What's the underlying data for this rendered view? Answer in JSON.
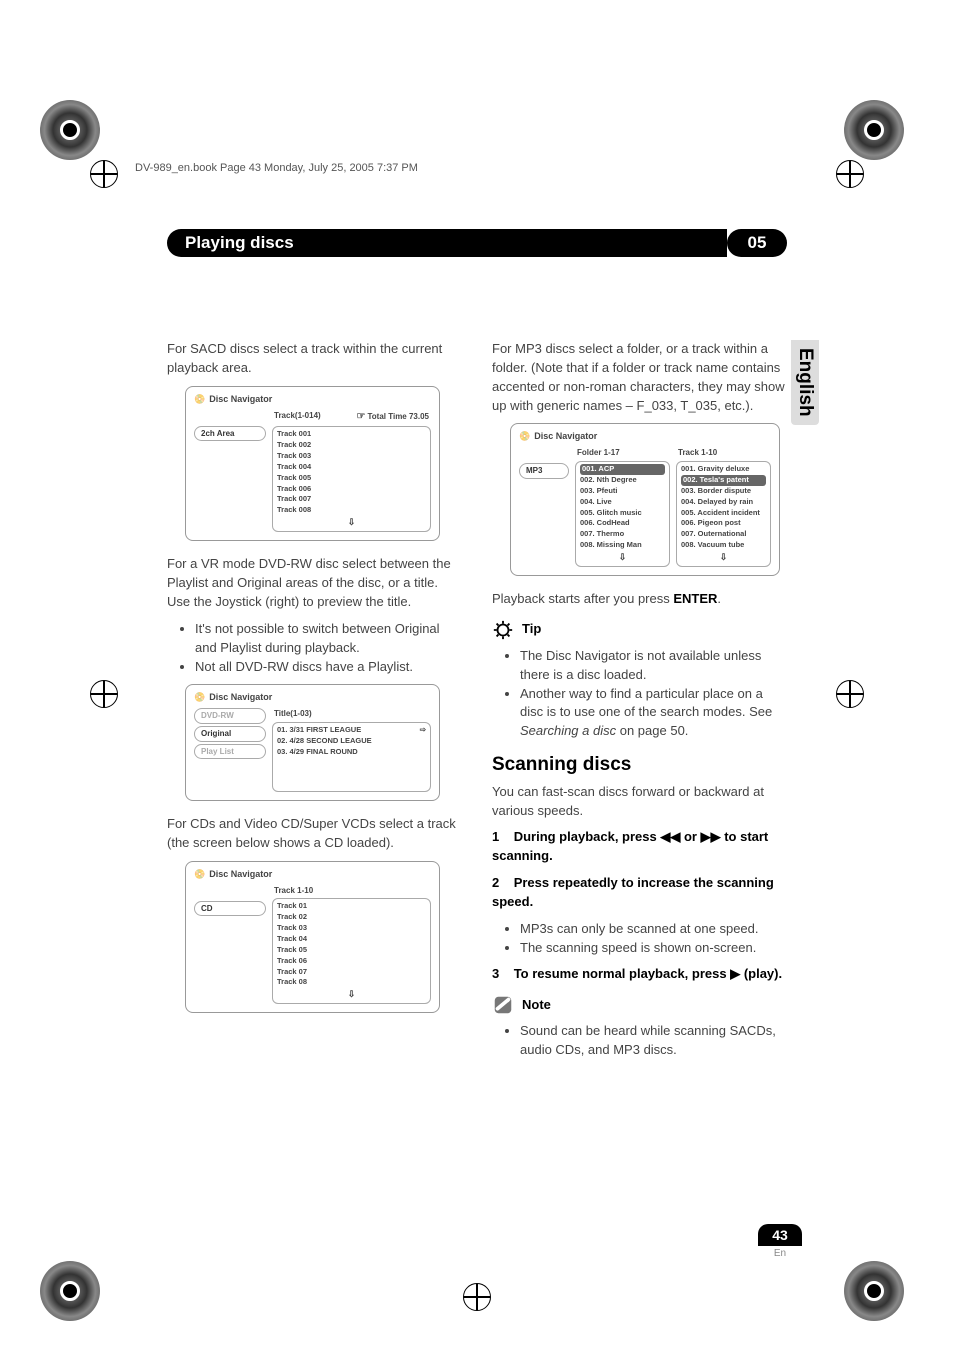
{
  "header_line": "DV-989_en.book  Page 43  Monday, July 25, 2005  7:37 PM",
  "title_bar": {
    "left": "Playing discs",
    "right": "05"
  },
  "side_tab": "English",
  "page_badge": {
    "num": "43",
    "lang": "En"
  },
  "left": {
    "p1": "For SACD discs select a track within the current playback area.",
    "nav1": {
      "title": "Disc Navigator",
      "chip1": "2ch Area",
      "header": {
        "range": "Track(1-014)",
        "total": "Total Time  73.05",
        "hand": true
      },
      "items": [
        "Track 001",
        "Track 002",
        "Track 003",
        "Track 004",
        "Track 005",
        "Track 006",
        "Track 007",
        "Track 008"
      ]
    },
    "p2": "For a VR mode DVD-RW disc select between the Playlist and Original areas of the disc, or a title. Use the Joystick (right) to preview the title.",
    "bullets1": [
      "It's not possible to switch between Original and Playlist during playback.",
      "Not all DVD-RW discs have a Playlist."
    ],
    "nav2": {
      "title": "Disc Navigator",
      "chips": [
        "DVD-RW",
        "Original",
        "Play List"
      ],
      "header": "Title(1-03)",
      "items": [
        "01. 3/31 FIRST LEAGUE",
        "02. 4/28 SECOND LEAGUE",
        "03. 4/29 FINAL ROUND"
      ]
    },
    "p3": "For CDs and Video CD/Super VCDs select a track (the screen below shows a CD loaded).",
    "nav3": {
      "title": "Disc Navigator",
      "chip1": "CD",
      "header": "Track 1-10",
      "items": [
        "Track 01",
        "Track 02",
        "Track 03",
        "Track 04",
        "Track 05",
        "Track 06",
        "Track 07",
        "Track 08"
      ]
    }
  },
  "right": {
    "p1": "For MP3 discs select a folder, or a track within a folder. (Note that if a folder or track name contains accented or non-roman characters, they may show up with generic names – F_033, T_035, etc.).",
    "nav4": {
      "title": "Disc Navigator",
      "chip1": "MP3",
      "col1_header": "Folder 1-17",
      "col2_header": "Track 1-10",
      "col1": [
        "001. ACP",
        "002. Nth Degree",
        "003. Pfeuti",
        "004. Live",
        "005. Glitch music",
        "006. CodHead",
        "007. Thermo",
        "008. Missing Man"
      ],
      "col2": [
        "001. Gravity deluxe",
        "002. Tesla's patent",
        "003. Border dispute",
        "004. Delayed by rain",
        "005. Accident incident",
        "006. Pigeon post",
        "007. Outernational",
        "008. Vacuum tube"
      ]
    },
    "p2_pre": "Playback starts after you press ",
    "p2_bold": "ENTER",
    "p2_post": ".",
    "tip_label": "Tip",
    "tip_bullets": [
      "The Disc Navigator is not available unless there is a disc loaded."
    ],
    "tip_bullet2_a": "Another way to find a particular place on a disc is to use one of the search modes. See ",
    "tip_bullet2_i": "Searching a disc",
    "tip_bullet2_b": " on page 50.",
    "h2": "Scanning discs",
    "p3": "You can fast-scan discs forward or backward at various speeds.",
    "step1_num": "1",
    "step1_a": "During playback, press ",
    "step1_sym1": "◀◀",
    "step1_mid": " or ",
    "step1_sym2": "▶▶",
    "step1_b": " to start scanning.",
    "step2_num": "2",
    "step2": "Press repeatedly to increase the scanning speed.",
    "step2_bullets": [
      "MP3s can only be scanned at one speed.",
      "The scanning speed is shown on-screen."
    ],
    "step3_num": "3",
    "step3_a": "To resume normal playback, press ",
    "step3_sym": "▶",
    "step3_b": " (play).",
    "note_label": "Note",
    "note_bullet": "Sound can be heard while scanning SACDs, audio CDs, and MP3 discs."
  }
}
